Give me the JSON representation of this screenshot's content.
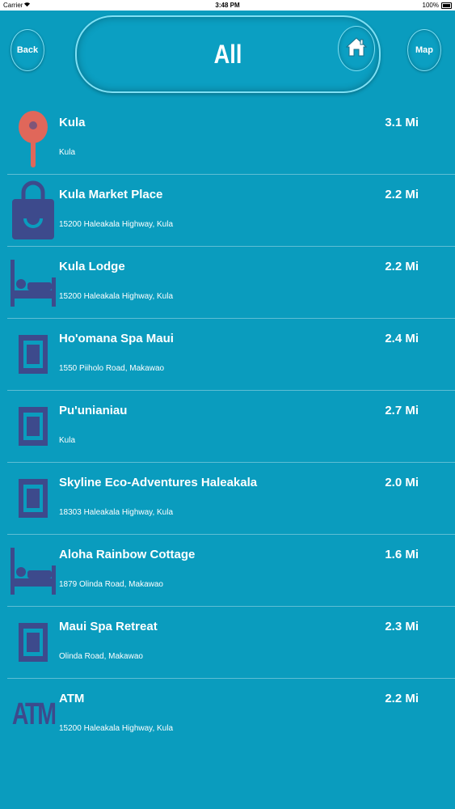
{
  "status_bar": {
    "carrier": "Carrier",
    "time": "3:48 PM",
    "battery": "100%"
  },
  "header": {
    "back_label": "Back",
    "title": "All",
    "map_label": "Map"
  },
  "colors": {
    "background": "#0a9cbe",
    "pin": "#e0675a",
    "icon_blue": "#3d4a8c"
  },
  "places": [
    {
      "name": "Kula",
      "address": "Kula",
      "distance": "3.1 Mi",
      "icon": "map-pin-icon"
    },
    {
      "name": "Kula Market Place",
      "address": "15200 Haleakala Highway, Kula",
      "distance": "2.2 Mi",
      "icon": "shopping-bag-icon"
    },
    {
      "name": "Kula Lodge",
      "address": "15200 Haleakala Highway, Kula",
      "distance": "2.2 Mi",
      "icon": "bed-icon"
    },
    {
      "name": "Ho'omana Spa Maui",
      "address": "1550 Piiholo Road, Makawao",
      "distance": "2.4 Mi",
      "icon": "square-frame-icon"
    },
    {
      "name": "Pu'unianiau",
      "address": "Kula",
      "distance": "2.7 Mi",
      "icon": "square-frame-icon"
    },
    {
      "name": "Skyline Eco-Adventures Haleakala",
      "address": "18303 Haleakala Highway, Kula",
      "distance": "2.0 Mi",
      "icon": "square-frame-icon"
    },
    {
      "name": "Aloha Rainbow Cottage",
      "address": "1879 Olinda Road, Makawao",
      "distance": "1.6 Mi",
      "icon": "bed-icon"
    },
    {
      "name": "Maui Spa Retreat",
      "address": "Olinda Road, Makawao",
      "distance": "2.3 Mi",
      "icon": "square-frame-icon"
    },
    {
      "name": "ATM",
      "address": "15200 Haleakala Highway, Kula",
      "distance": "2.2 Mi",
      "icon": "atm-icon",
      "icon_text": "ATM"
    }
  ]
}
